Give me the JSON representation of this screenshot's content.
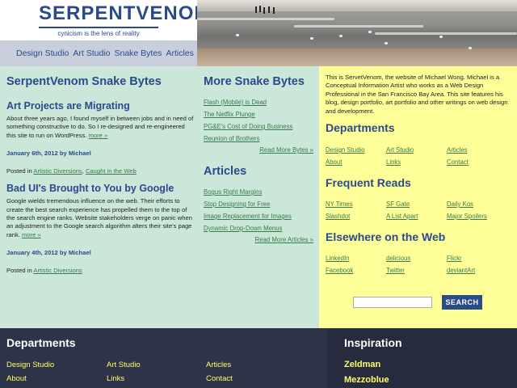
{
  "header": {
    "logo_text": "SERPENTVENOM",
    "tagline": "cynicism is the lens of reality",
    "nav": [
      "Design Studio",
      "Art Studio",
      "Snake Bytes",
      "Articles"
    ]
  },
  "main": {
    "title": "SerpentVenom Snake Bytes",
    "posts": [
      {
        "title": "Art Projects are Migrating",
        "excerpt": "About three years ago, I found myself in between jobs and in need of something constructive to do. So I re-designed and re-engineered this site to run on WordPress.",
        "more": "more »",
        "date": "January 6th, 2012 by Michael",
        "posted_prefix": "Posted in",
        "categories": [
          "Artistic Diversions",
          "Caught in the Web"
        ]
      },
      {
        "title": "Bad UI's Brought to You by Google",
        "excerpt": "Google wields tremendous influence on the web. Their efforts to create the best search experience has propelled them to the top of the search engine ranks. Website stakeholders verge on panic when an adjustment to the Google search algorithm alters their site's page rank.",
        "more": "more »",
        "date": "January 4th, 2012 by Michael",
        "posted_prefix": "Posted in",
        "categories": [
          "Artistic Diversions"
        ]
      }
    ]
  },
  "sidebar_mid": {
    "more_title": "More Snake Bytes",
    "more_links": [
      "Flash (Mobile) is Dead",
      "The Netflix Plunge",
      "PG&E's Cost of Doing Business",
      "Reunion of Brothers"
    ],
    "more_read": "Read More Bytes »",
    "articles_title": "Articles",
    "article_links": [
      "Bogus Right Margins",
      "Stop Designing for Free",
      "Image Replacement for Images",
      "Dynamic Drop-Down Menus"
    ],
    "articles_read": "Read More Articles »"
  },
  "right": {
    "about": "This is ServetVenom, the website of Michael Wong. Michael is a Conceptual Information Artist who works as a Web Design Professional in the San Francisco Bay Area. This site features his blog, design portfolio, art portfolio and other writings on web design and development.",
    "departments_title": "Departments",
    "departments": [
      "Design Studio",
      "Art Studio",
      "Articles",
      "About",
      "Links",
      "Contact"
    ],
    "reads_title": "Frequent Reads",
    "reads": [
      "NY Times",
      "SF Gate",
      "Daily Kos",
      "Slashdot",
      "A List Apart",
      "Major Spoilers"
    ],
    "elsewhere_title": "Elsewhere on the Web",
    "elsewhere": [
      "LinkedIn",
      "delicious",
      "Flickr",
      "Facebook",
      "Twitter",
      "deviantArt"
    ],
    "search_button": "SEARCH",
    "search_value": ""
  },
  "footer": {
    "departments_title": "Departments",
    "departments": [
      "Design Studio",
      "Art Studio",
      "Articles",
      "About",
      "Links",
      "Contact"
    ],
    "inspiration_title": "Inspiration",
    "inspiration": [
      "Zeldman",
      "Mezzoblue"
    ]
  }
}
